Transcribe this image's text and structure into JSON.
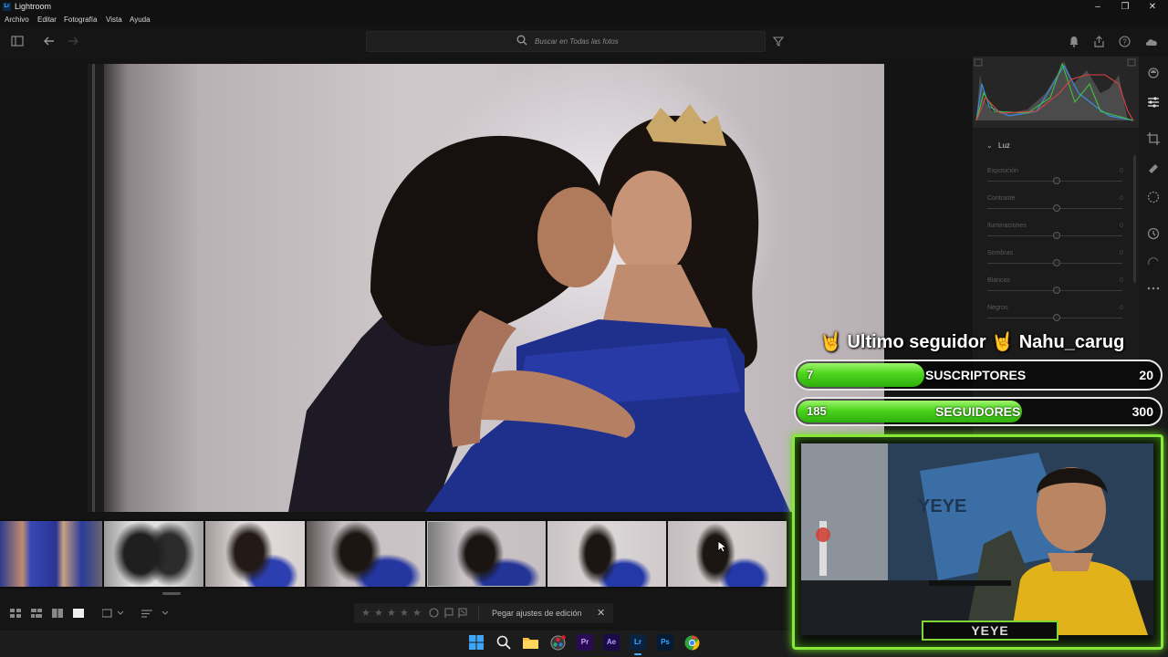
{
  "app": {
    "title": "Lightroom",
    "badge": "Lr"
  },
  "window_controls": {
    "minimize": "–",
    "maximize": "❐",
    "close": "✕"
  },
  "menu": [
    "Archivo",
    "Editar",
    "Fotografía",
    "Vista",
    "Ayuda"
  ],
  "search": {
    "placeholder": "Buscar en Todas las fotos"
  },
  "right_panel": {
    "section": "Luz",
    "sliders": [
      {
        "label": "Exposición",
        "value": "0"
      },
      {
        "label": "Contraste",
        "value": "0"
      },
      {
        "label": "Iluminaciones",
        "value": "0"
      },
      {
        "label": "Sombras",
        "value": "0"
      },
      {
        "label": "Blancos",
        "value": "0"
      },
      {
        "label": "Negros",
        "value": "0"
      }
    ]
  },
  "bottom_bar": {
    "rating_stars": [
      "★",
      "★",
      "★",
      "★",
      "★"
    ],
    "paste_label": "Pegar ajustes de edición",
    "close_label": "✕"
  },
  "overlay": {
    "follower_prefix": "Ultimo seguidor",
    "follower_name": "Nahu_carug",
    "subs": {
      "current": "7",
      "label": "SUSCRIPTORES",
      "goal": "20",
      "progress": 0.35
    },
    "followers": {
      "current": "185",
      "label": "SEGUIDORES",
      "goal": "300",
      "progress": 0.62
    },
    "webcam_tag": "YEYE",
    "wall_text": "YEYE"
  },
  "taskbar": {
    "apps": [
      {
        "name": "windows",
        "label": ""
      },
      {
        "name": "search",
        "label": ""
      },
      {
        "name": "explorer",
        "label": ""
      },
      {
        "name": "davinci",
        "label": ""
      },
      {
        "name": "premiere",
        "label": "Pr"
      },
      {
        "name": "after-effects",
        "label": "Ae"
      },
      {
        "name": "lightroom",
        "label": "Lr"
      },
      {
        "name": "photoshop",
        "label": "Ps"
      },
      {
        "name": "chrome",
        "label": ""
      }
    ]
  },
  "colors": {
    "accent_green": "#4bd41c",
    "frame_green": "#88e83a",
    "lr_blue": "#4aa8ff"
  }
}
